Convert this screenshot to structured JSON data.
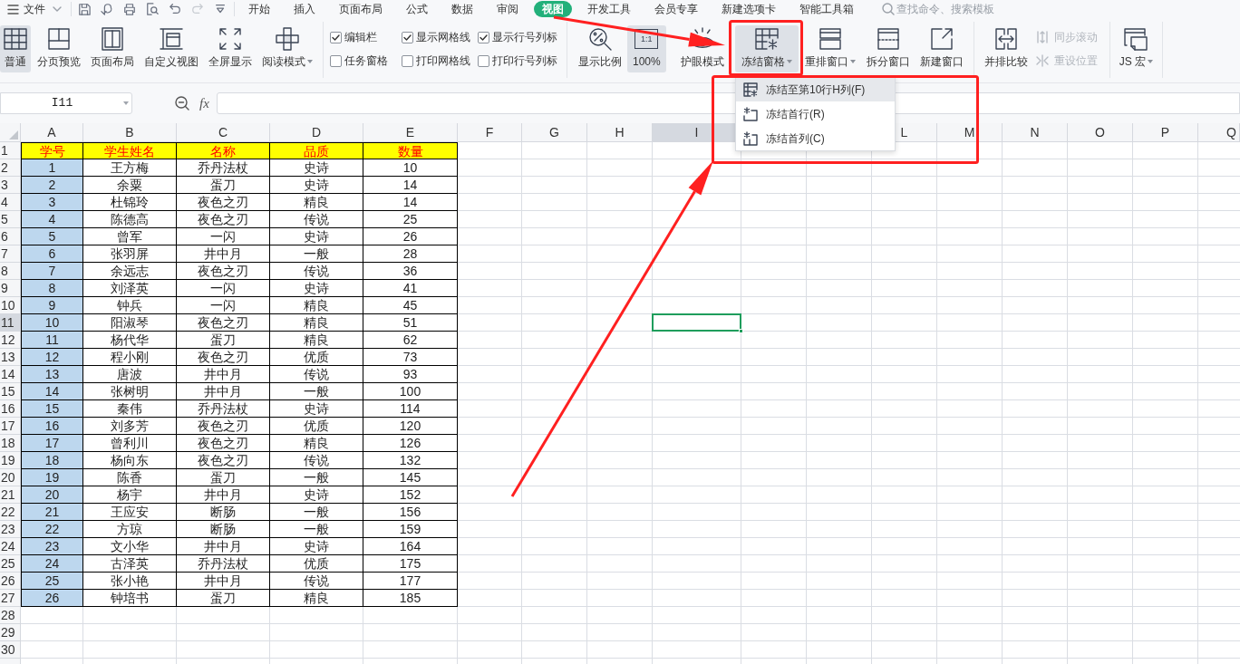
{
  "menu_bar": {
    "file": "文件",
    "quick_access": [
      {
        "disabled": false
      },
      {
        "disabled": false
      },
      {
        "disabled": false
      },
      {
        "disabled": false
      },
      {
        "disabled": false
      },
      {
        "disabled": true
      },
      {
        "disabled": false
      }
    ],
    "tabs": [
      {
        "label": "开始",
        "selected": false
      },
      {
        "label": "插入",
        "selected": false
      },
      {
        "label": "页面布局",
        "selected": false
      },
      {
        "label": "公式",
        "selected": false
      },
      {
        "label": "数据",
        "selected": false
      },
      {
        "label": "审阅",
        "selected": false
      },
      {
        "label": "视图",
        "selected": true
      },
      {
        "label": "开发工具",
        "selected": false
      },
      {
        "label": "会员专享",
        "selected": false
      },
      {
        "label": "新建选项卡",
        "selected": false
      },
      {
        "label": "智能工具箱",
        "selected": false
      }
    ],
    "search": {
      "placeholder": "查找命令、搜索模板"
    }
  },
  "ribbon": {
    "view_modes": [
      {
        "label": "普通",
        "selected": true
      },
      {
        "label": "分页预览",
        "selected": false
      },
      {
        "label": "页面布局",
        "selected": false
      },
      {
        "label": "自定义视图",
        "selected": false
      },
      {
        "label": "全屏显示",
        "selected": false
      },
      {
        "label": "阅读模式",
        "selected": false,
        "dropdown": true
      }
    ],
    "checkboxes": [
      {
        "label": "编辑栏",
        "checked": true
      },
      {
        "label": "任务窗格",
        "checked": false
      },
      {
        "label": "显示网格线",
        "checked": true
      },
      {
        "label": "打印网格线",
        "checked": false
      },
      {
        "label": "显示行号列标",
        "checked": true
      },
      {
        "label": "打印行号列标",
        "checked": false
      }
    ],
    "zoom": [
      {
        "label": "显示比例",
        "selected": false
      },
      {
        "label": "100%",
        "icon_text": "1:1",
        "selected": true
      }
    ],
    "eye_mode": {
      "label": "护眼模式"
    },
    "windows": [
      {
        "label": "冻结窗格",
        "dropdown": true,
        "expanded": true,
        "menu": [
          {
            "label": "冻结至第10行H列(F)",
            "selected": true
          },
          {
            "label": "冻结首行(R)",
            "selected": false
          },
          {
            "label": "冻结首列(C)",
            "selected": false
          }
        ]
      },
      {
        "label": "重排窗口",
        "dropdown": true
      },
      {
        "label": "拆分窗口"
      },
      {
        "label": "新建窗口"
      }
    ],
    "compare": {
      "label": "并排比较"
    },
    "sync": [
      {
        "label": "同步滚动",
        "disabled": true
      },
      {
        "label": "重设位置",
        "disabled": true
      }
    ],
    "macro": {
      "label": "JS 宏",
      "dropdown": true
    }
  },
  "formula_bar": {
    "name_box": "I11",
    "function_label": "fx"
  },
  "sheet": {
    "columns": [
      {
        "label": "A",
        "selected": false
      },
      {
        "label": "B",
        "selected": false
      },
      {
        "label": "C",
        "selected": false
      },
      {
        "label": "D",
        "selected": false
      },
      {
        "label": "E",
        "selected": false
      },
      {
        "label": "F",
        "selected": false
      },
      {
        "label": "G",
        "selected": false
      },
      {
        "label": "H",
        "selected": false
      },
      {
        "label": "I",
        "selected": true
      },
      {
        "label": "L",
        "selected": false
      },
      {
        "label": "M",
        "selected": false
      },
      {
        "label": "N",
        "selected": false
      },
      {
        "label": "O",
        "selected": false
      },
      {
        "label": "P",
        "selected": false
      },
      {
        "label": "Q",
        "selected": false
      }
    ],
    "rows": [
      {
        "label": "1",
        "selected": false
      },
      {
        "label": "2",
        "selected": false
      },
      {
        "label": "3",
        "selected": false
      },
      {
        "label": "4",
        "selected": false
      },
      {
        "label": "5",
        "selected": false
      },
      {
        "label": "6",
        "selected": false
      },
      {
        "label": "7",
        "selected": false
      },
      {
        "label": "8",
        "selected": false
      },
      {
        "label": "9",
        "selected": false
      },
      {
        "label": "10",
        "selected": false
      },
      {
        "label": "11",
        "selected": true
      },
      {
        "label": "12",
        "selected": false
      },
      {
        "label": "13",
        "selected": false
      },
      {
        "label": "14",
        "selected": false
      },
      {
        "label": "15",
        "selected": false
      },
      {
        "label": "16",
        "selected": false
      },
      {
        "label": "17",
        "selected": false
      },
      {
        "label": "18",
        "selected": false
      },
      {
        "label": "19",
        "selected": false
      },
      {
        "label": "20",
        "selected": false
      },
      {
        "label": "21",
        "selected": false
      },
      {
        "label": "22",
        "selected": false
      },
      {
        "label": "23",
        "selected": false
      },
      {
        "label": "24",
        "selected": false
      },
      {
        "label": "25",
        "selected": false
      },
      {
        "label": "26",
        "selected": false
      },
      {
        "label": "27",
        "selected": false
      },
      {
        "label": "28",
        "selected": false
      },
      {
        "label": "29",
        "selected": false
      },
      {
        "label": "30",
        "selected": false
      }
    ],
    "table": {
      "header": [
        "学号",
        "学生姓名",
        "名称",
        "品质",
        "数量"
      ],
      "rows": [
        [
          "1",
          "王方梅",
          "乔丹法杖",
          "史诗",
          "10"
        ],
        [
          "2",
          "余粟",
          "蛋刀",
          "史诗",
          "14"
        ],
        [
          "3",
          "杜锦玲",
          "夜色之刃",
          "精良",
          "14"
        ],
        [
          "4",
          "陈德高",
          "夜色之刃",
          "传说",
          "25"
        ],
        [
          "5",
          "曾军",
          "一闪",
          "史诗",
          "26"
        ],
        [
          "6",
          "张羽屏",
          "井中月",
          "一般",
          "28"
        ],
        [
          "7",
          "余远志",
          "夜色之刃",
          "传说",
          "36"
        ],
        [
          "8",
          "刘泽英",
          "一闪",
          "史诗",
          "41"
        ],
        [
          "9",
          "钟兵",
          "一闪",
          "精良",
          "45"
        ],
        [
          "10",
          "阳淑琴",
          "夜色之刃",
          "精良",
          "51"
        ],
        [
          "11",
          "杨代华",
          "蛋刀",
          "精良",
          "62"
        ],
        [
          "12",
          "程小刚",
          "夜色之刃",
          "优质",
          "73"
        ],
        [
          "13",
          "唐波",
          "井中月",
          "传说",
          "93"
        ],
        [
          "14",
          "张树明",
          "井中月",
          "一般",
          "100"
        ],
        [
          "15",
          "秦伟",
          "乔丹法杖",
          "史诗",
          "114"
        ],
        [
          "16",
          "刘多芳",
          "夜色之刃",
          "优质",
          "120"
        ],
        [
          "17",
          "曾利川",
          "夜色之刃",
          "精良",
          "126"
        ],
        [
          "18",
          "杨向东",
          "夜色之刃",
          "传说",
          "132"
        ],
        [
          "19",
          "陈香",
          "蛋刀",
          "一般",
          "145"
        ],
        [
          "20",
          "杨宇",
          "井中月",
          "史诗",
          "152"
        ],
        [
          "21",
          "王应安",
          "断肠",
          "一般",
          "156"
        ],
        [
          "22",
          "方琼",
          "断肠",
          "一般",
          "159"
        ],
        [
          "23",
          "文小华",
          "井中月",
          "史诗",
          "164"
        ],
        [
          "24",
          "古泽英",
          "乔丹法杖",
          "优质",
          "175"
        ],
        [
          "25",
          "张小艳",
          "井中月",
          "传说",
          "177"
        ],
        [
          "26",
          "钟培书",
          "蛋刀",
          "精良",
          "185"
        ]
      ]
    }
  },
  "annotations": [
    {
      "kind": "box"
    },
    {
      "kind": "box"
    },
    {
      "kind": "arrow"
    },
    {
      "kind": "arrow"
    }
  ]
}
